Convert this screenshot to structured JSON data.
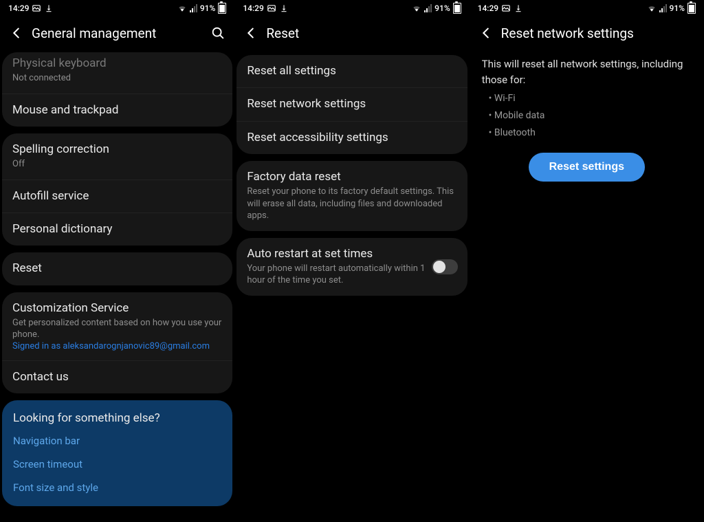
{
  "status": {
    "time": "14:29",
    "battery": "91%"
  },
  "pane1": {
    "title": "General management",
    "groups": [
      {
        "id": "input-devices",
        "rows": [
          {
            "name": "physical-keyboard",
            "t": "Physical keyboard",
            "s": "Not connected",
            "cut": true
          },
          {
            "name": "mouse-trackpad",
            "t": "Mouse and trackpad"
          }
        ]
      },
      {
        "id": "text-services",
        "rows": [
          {
            "name": "spelling-correction",
            "t": "Spelling correction",
            "s": "Off"
          },
          {
            "name": "autofill-service",
            "t": "Autofill service"
          },
          {
            "name": "personal-dictionary",
            "t": "Personal dictionary"
          }
        ]
      },
      {
        "id": "reset",
        "rows": [
          {
            "name": "reset",
            "t": "Reset"
          }
        ]
      },
      {
        "id": "services",
        "rows": [
          {
            "name": "customization-service",
            "t": "Customization Service",
            "s": "Get personalized content based on how you use your phone.",
            "link": "Signed in as aleksandarognjanovic89@gmail.com"
          },
          {
            "name": "contact-us",
            "t": "Contact us"
          }
        ]
      }
    ],
    "suggestions": {
      "header": "Looking for something else?",
      "links": [
        "Navigation bar",
        "Screen timeout",
        "Font size and style"
      ]
    }
  },
  "pane2": {
    "title": "Reset",
    "groups": [
      {
        "id": "resets",
        "rows": [
          {
            "name": "reset-all-settings",
            "t": "Reset all settings"
          },
          {
            "name": "reset-network-settings",
            "t": "Reset network settings"
          },
          {
            "name": "reset-accessibility-settings",
            "t": "Reset accessibility settings"
          }
        ]
      },
      {
        "id": "factory",
        "rows": [
          {
            "name": "factory-data-reset",
            "t": "Factory data reset",
            "s": "Reset your phone to its factory default settings. This will erase all data, including files and downloaded apps."
          }
        ]
      },
      {
        "id": "auto-restart",
        "rows": [
          {
            "name": "auto-restart",
            "t": "Auto restart at set times",
            "s": "Your phone will restart automatically within 1 hour of the time you set.",
            "toggle": false
          }
        ]
      }
    ]
  },
  "pane3": {
    "title": "Reset network settings",
    "intro": "This will reset all network settings, including those for:",
    "bullets": [
      "Wi-Fi",
      "Mobile data",
      "Bluetooth"
    ],
    "button": "Reset settings"
  }
}
